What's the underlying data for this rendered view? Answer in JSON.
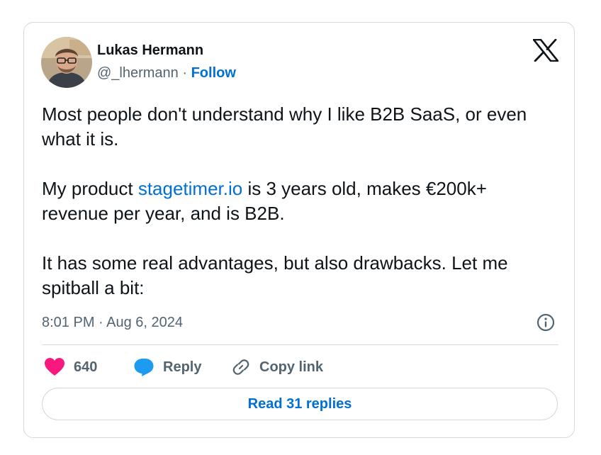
{
  "author": {
    "name": "Lukas Hermann",
    "handle": "@_lhermann",
    "separator": " · ",
    "follow_label": "Follow"
  },
  "icons": {
    "avatar": "avatar-photo",
    "platform": "x-logo-icon",
    "info": "info-icon",
    "like": "heart-icon",
    "reply": "speech-bubble-icon",
    "copy_link": "link-icon"
  },
  "tweet": {
    "para1": "Most people don't understand why I like B2B SaaS, or even what it is.",
    "para2_before": "My product ",
    "para2_link": "stagetimer.io",
    "para2_after": " is 3 years old, makes €200k+ revenue per year, and is B2B.",
    "para3": "It has some real advantages, but also drawbacks. Let me spitball a bit:",
    "timestamp": "8:01 PM · Aug 6, 2024"
  },
  "actions": {
    "like_count": "640",
    "reply_label": "Reply",
    "copy_link_label": "Copy link",
    "read_replies_label": "Read 31 replies"
  },
  "colors": {
    "link": "#006fd6",
    "like": "#f91880",
    "reply": "#1d9bf0",
    "muted": "#536471",
    "border": "#cfd9de"
  }
}
